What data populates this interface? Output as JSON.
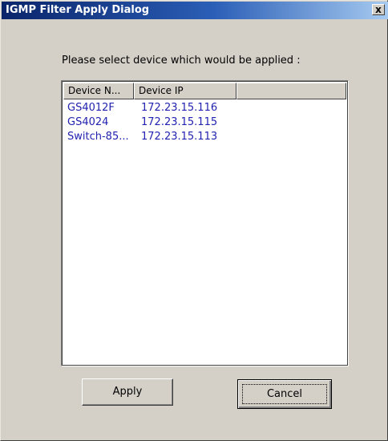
{
  "window": {
    "title": "IGMP Filter Apply Dialog",
    "close_label": "x"
  },
  "prompt": "Please select device which would be applied :",
  "device_list": {
    "columns": [
      "Device N...",
      "Device IP",
      ""
    ],
    "rows": [
      {
        "name": "GS4012F",
        "ip": "172.23.15.116"
      },
      {
        "name": "GS4024",
        "ip": "172.23.15.115"
      },
      {
        "name": "Switch-85...",
        "ip": "172.23.15.113"
      }
    ]
  },
  "buttons": {
    "apply_label": "Apply",
    "cancel_label": "Cancel"
  },
  "colors": {
    "titlebar_start": "#0a246a",
    "titlebar_end": "#a6caf0",
    "dialog_face": "#d4d0c8",
    "row_text": "#2222b0"
  }
}
